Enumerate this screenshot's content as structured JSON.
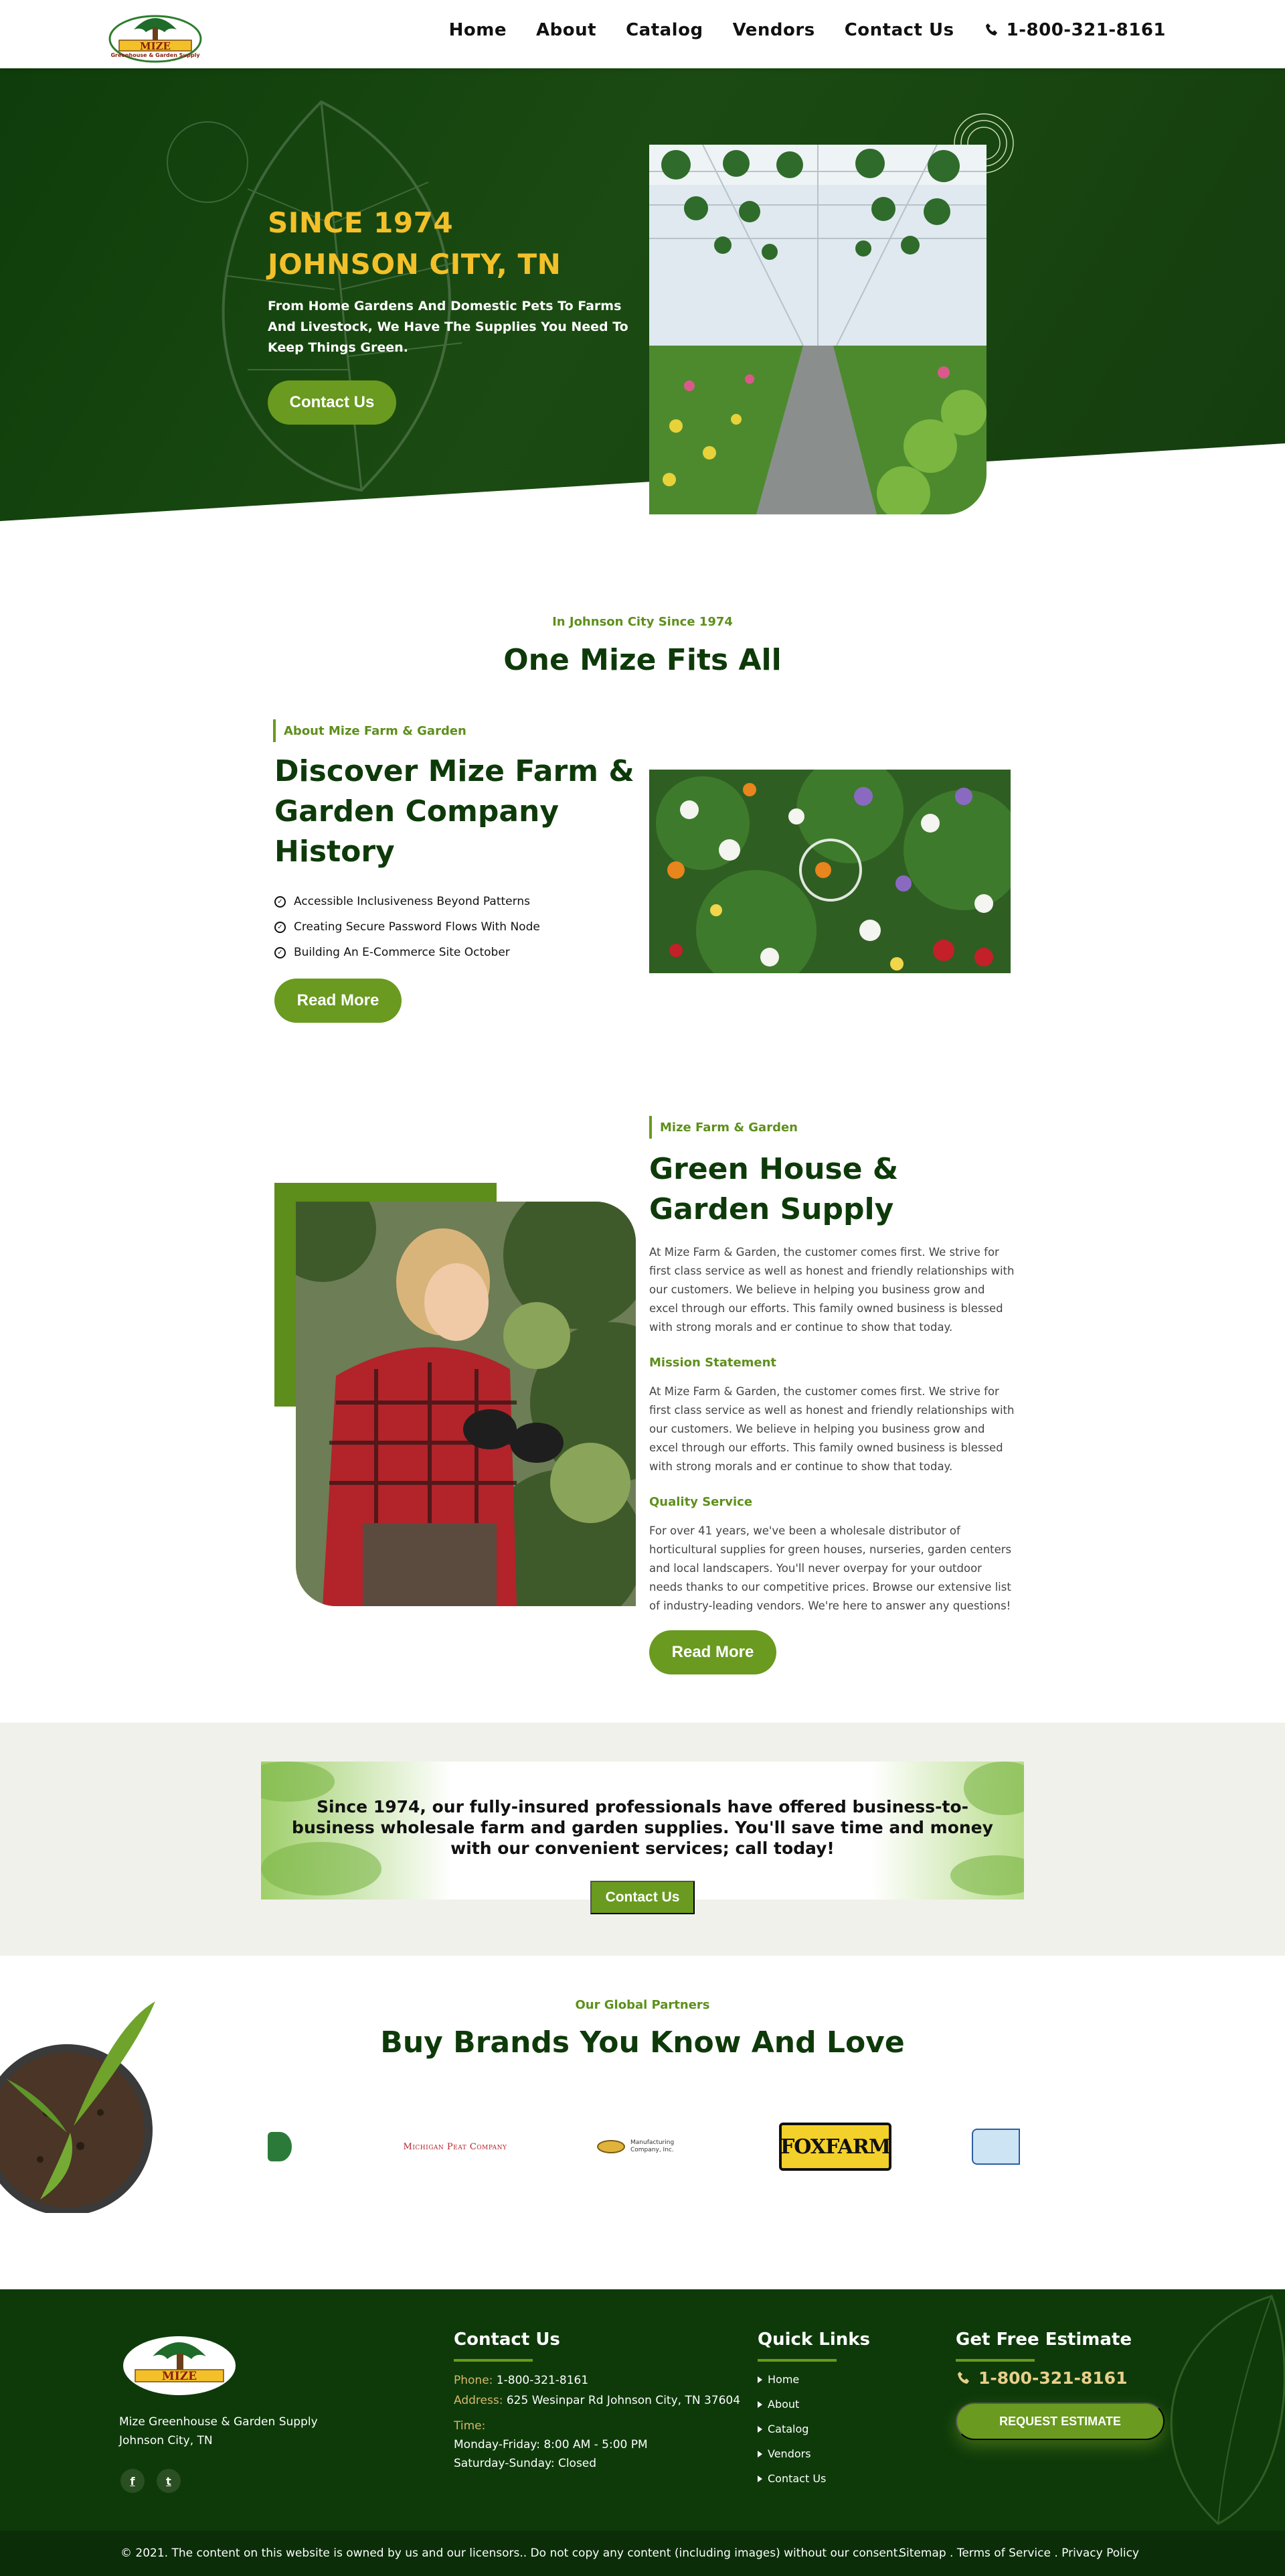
{
  "header": {
    "logo_text": "MIZE",
    "logo_sub": "Greenhouse & Garden Supply",
    "nav": [
      "Home",
      "About",
      "Catalog",
      "Vendors",
      "Contact Us"
    ],
    "phone": "1-800-321-8161"
  },
  "hero": {
    "line1": "SINCE 1974",
    "line2": "JOHNSON CITY, TN",
    "text": "From Home Gardens And Domestic Pets To Farms And Livestock, We Have The Supplies You Need To Keep Things Green.",
    "button": "Contact Us"
  },
  "about": {
    "sub": "In Johnson City Since 1974",
    "heading": "One Mize Fits All",
    "tag": "About Mize Farm & Garden",
    "title": "Discover Mize Farm & Garden Company History",
    "bullets": [
      "Accessible Inclusiveness Beyond Patterns",
      "Creating Secure Password Flows With Node",
      "Building An E-Commerce Site October"
    ],
    "button": "Read More"
  },
  "greenhouse": {
    "tag": "Mize Farm & Garden",
    "title": "Green House & Garden Supply",
    "p1": "At Mize Farm & Garden, the customer comes first. We strive for first class service as well as honest and friendly relationships with our customers. We believe in helping you business grow and excel through our efforts. This family owned business is blessed with strong morals and er continue to show that today.",
    "mission_label": "Mission Statement",
    "p2": "At Mize Farm & Garden, the customer comes first. We strive for first class service as well as honest and friendly relationships with our customers. We believe in helping you business grow and excel through our efforts. This family owned business is blessed with strong morals and er continue to show that today.",
    "quality_label": "Quality Service",
    "p3": "For over 41 years, we've been a wholesale distributor of horticultural supplies for green houses, nurseries, garden centers and local landscapers. You'll never overpay for your outdoor needs thanks to our competitive prices. Browse our extensive list of industry-leading vendors. We're here to answer any questions!",
    "button": "Read More"
  },
  "cta": {
    "text": "Since 1974, our fully-insured professionals have offered business-to-business wholesale farm and garden supplies. You'll save time and money with our convenient services; call today!",
    "button": "Contact Us"
  },
  "partners": {
    "sub": "Our Global Partners",
    "heading": "Buy Brands You Know And Love",
    "brands": [
      "Michigan Peat Company",
      "Manufacturing Company, Inc.",
      "FOXFARM"
    ]
  },
  "footer": {
    "company": "Mize Greenhouse & Garden Supply",
    "city": "Johnson City, TN",
    "contact_title": "Contact Us",
    "phone_label": "Phone:",
    "phone": "1-800-321-8161",
    "address_label": "Address:",
    "address": "625 Wesinpar Rd Johnson City, TN 37604",
    "time_label": "Time:",
    "hours1": "Monday-Friday: 8:00 AM - 5:00 PM",
    "hours2": "Saturday-Sunday: Closed",
    "quick_title": "Quick Links",
    "quick": [
      "Home",
      "About",
      "Catalog",
      "Vendors",
      "Contact Us"
    ],
    "estimate_title": "Get Free Estimate",
    "estimate_phone": "1-800-321-8161",
    "request": "REQUEST ESTIMATE",
    "copyright": "© 2021. The content on this website is owned by us and our licensors.. Do not copy any content (including images) without our consent.",
    "legal": "Sitemap . Terms of Service . Privacy Policy"
  },
  "colors": {
    "dark_green": "#0e3a0a",
    "accent_green": "#6a9a1f",
    "gold": "#f3c02a"
  }
}
